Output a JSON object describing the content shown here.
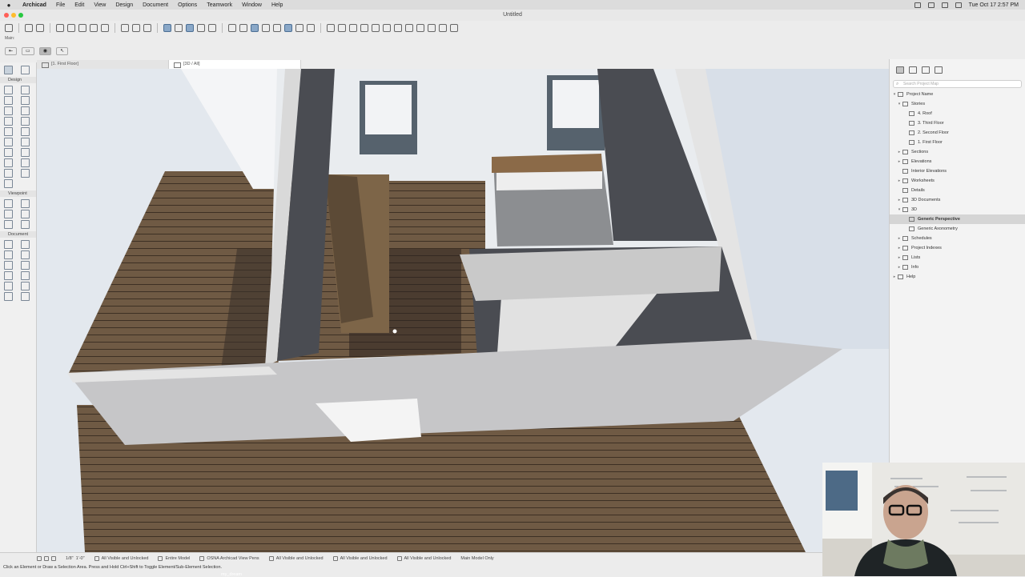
{
  "menubar": {
    "app": "Archicad",
    "menus": [
      "File",
      "Edit",
      "View",
      "Design",
      "Document",
      "Options",
      "Teamwork",
      "Window",
      "Help"
    ],
    "clock": "Tue Oct 17  2:57 PM"
  },
  "window": {
    "title": "Untitled"
  },
  "infobox": {
    "label": "Main:"
  },
  "tabs": [
    {
      "label": "[1. First Floor]"
    },
    {
      "label": "[3D / All]"
    }
  ],
  "toolbox": {
    "sections": [
      {
        "label": "Design"
      },
      {
        "label": "Viewpoint"
      },
      {
        "label": "Document"
      }
    ]
  },
  "navigator": {
    "search_placeholder": "Search Project Map",
    "root": "Project Name",
    "items": [
      {
        "label": "Stories",
        "level": 1,
        "expanded": true
      },
      {
        "label": "4. Roof",
        "level": 2
      },
      {
        "label": "3. Third Floor",
        "level": 2
      },
      {
        "label": "2. Second Floor",
        "level": 2
      },
      {
        "label": "1. First Floor",
        "level": 2
      },
      {
        "label": "Sections",
        "level": 1
      },
      {
        "label": "Elevations",
        "level": 1
      },
      {
        "label": "Interior Elevations",
        "level": 1
      },
      {
        "label": "Worksheets",
        "level": 1
      },
      {
        "label": "Details",
        "level": 1
      },
      {
        "label": "3D Documents",
        "level": 1
      },
      {
        "label": "3D",
        "level": 1,
        "expanded": true
      },
      {
        "label": "Generic Perspective",
        "level": 2,
        "selected": true
      },
      {
        "label": "Generic Axonometry",
        "level": 2
      },
      {
        "label": "Schedules",
        "level": 1
      },
      {
        "label": "Project Indexes",
        "level": 1
      },
      {
        "label": "Lists",
        "level": 1
      },
      {
        "label": "Info",
        "level": 1
      },
      {
        "label": "Help",
        "level": 0
      }
    ]
  },
  "statusbar": {
    "scale": "1/8\"",
    "unit": "1'-0\"",
    "layers": "All Visible and Unlocked",
    "model_filter": "Entire Model",
    "pen_set": "OSNA Archicad View Pens",
    "graphic_override": "All Visible and Unlocked",
    "renovation": "All Visible and Unlocked",
    "structural": "All Visible and Unlocked",
    "model_only": "Main Model Only",
    "hint": "Click an Element or Draw a Selection Area. Press and Hold Ctrl+Shift to Toggle Element/Sub-Element Selection.",
    "view_name": "my_dream"
  },
  "colors": {
    "accent": "#4c6f94",
    "floor": "#6f5a44",
    "wall": "#dcdcdc",
    "dark_wall": "#4a4c52"
  }
}
